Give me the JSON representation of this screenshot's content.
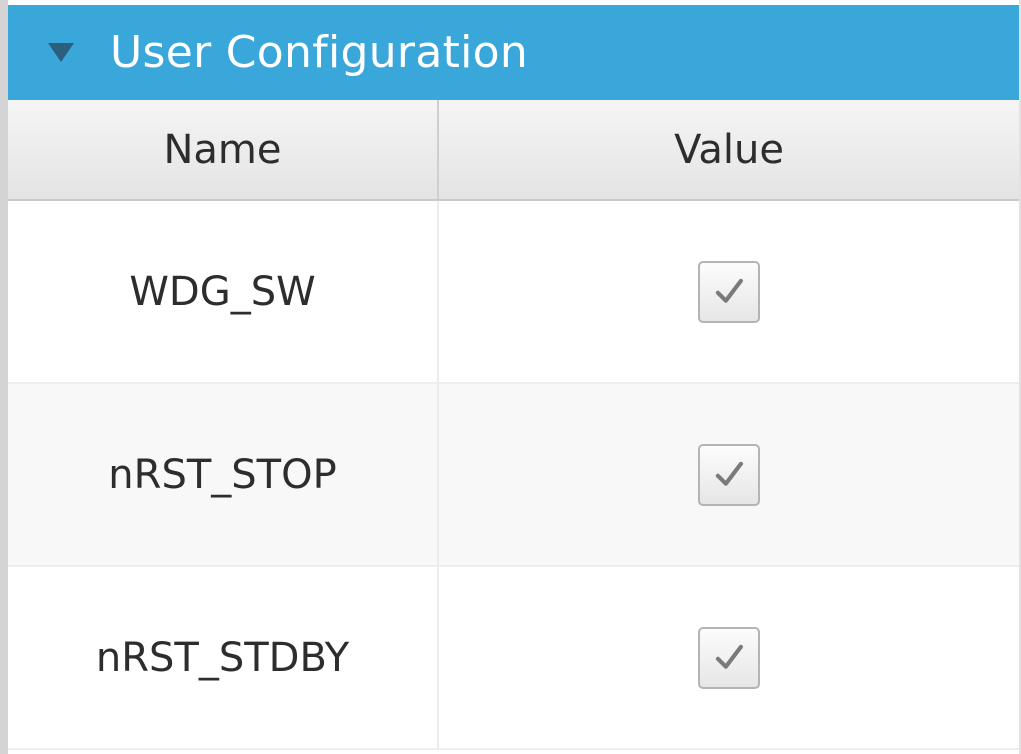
{
  "panel": {
    "title": "User Configuration",
    "expanded": true,
    "collapse_icon": "triangle-down-icon"
  },
  "table": {
    "columns": [
      "Name",
      "Value"
    ],
    "rows": [
      {
        "name": "WDG_SW",
        "checked": true
      },
      {
        "name": "nRST_STOP",
        "checked": true
      },
      {
        "name": "nRST_STDBY",
        "checked": true
      }
    ]
  },
  "colors": {
    "header_bg": "#3aa7db",
    "header_text": "#ffffff",
    "check_mark": "#7a7a7a"
  }
}
